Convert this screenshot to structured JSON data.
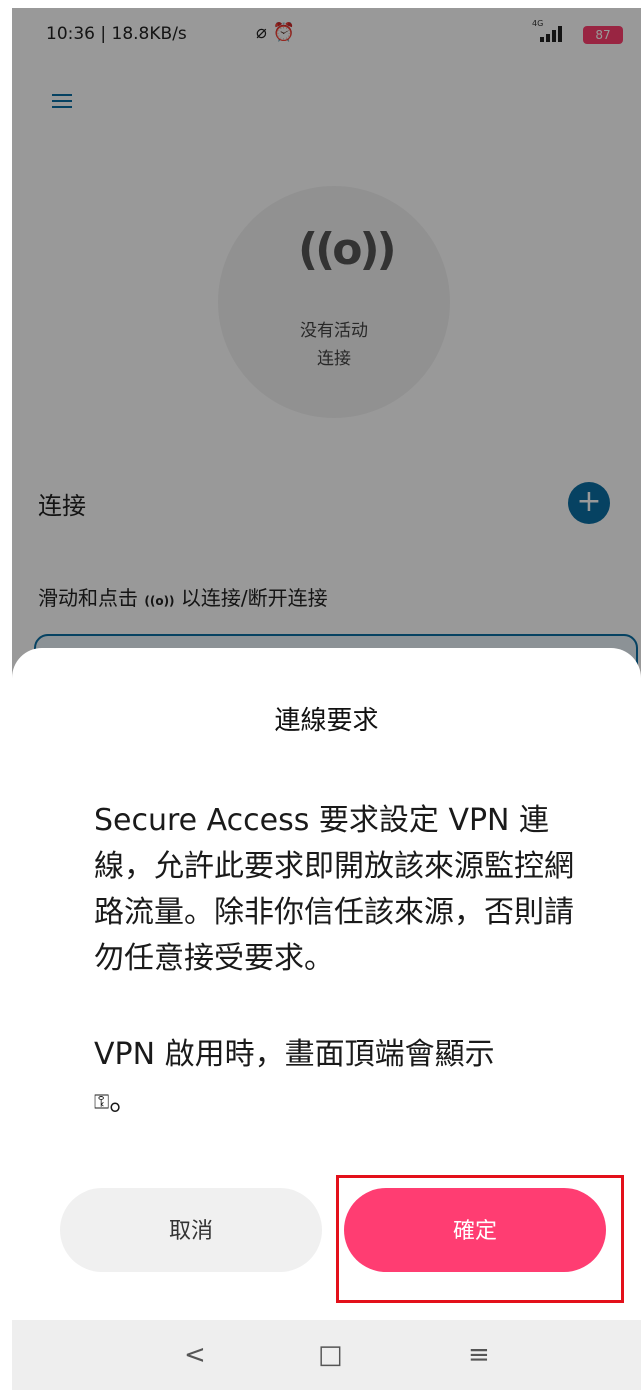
{
  "status_bar": {
    "time_speed": "10:36 | 18.8KB/s",
    "icons": "⌀ ⏰",
    "net_type": "4G",
    "battery": "87"
  },
  "app": {
    "circle_status_line1": "没有活动",
    "circle_status_line2": "连接",
    "connections_title": "连接",
    "hint_before": "滑动和点击 ",
    "hint_icon": "((o))",
    "hint_after": " 以连接/断开连接"
  },
  "dialog": {
    "title": "連線要求",
    "body": "Secure Access 要求設定 VPN 連線，允許此要求即開放該來源監控網路流量。除非你信任該來源，否則請勿任意接受要求。",
    "note_text": "VPN 啟用時，畫面頂端會顯示",
    "note_icon": "⚿",
    "note_end": "。",
    "cancel_label": "取消",
    "ok_label": "確定"
  },
  "nav": {
    "back": "<",
    "home": "□",
    "recents": "≡"
  }
}
